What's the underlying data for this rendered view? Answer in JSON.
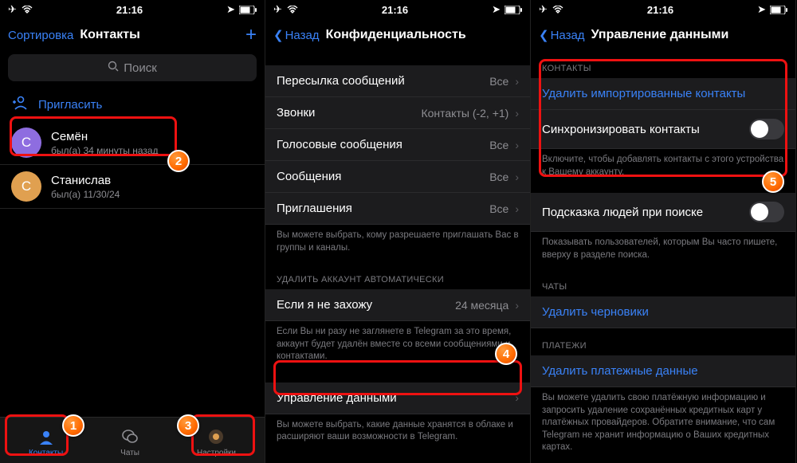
{
  "statusbar": {
    "time": "21:16"
  },
  "screen1": {
    "sort": "Сортировка",
    "title": "Контакты",
    "search_placeholder": "Поиск",
    "invite": "Пригласить",
    "contacts": [
      {
        "initial": "С",
        "name": "Семён",
        "status": "был(а) 34 минуты назад"
      },
      {
        "initial": "С",
        "name": "Станислав",
        "status": "был(а) 11/30/24"
      }
    ],
    "tabs": {
      "contacts": "Контакты",
      "chats": "Чаты",
      "settings": "Настройки"
    }
  },
  "screen2": {
    "back": "Назад",
    "title": "Конфиденциальность",
    "rows": [
      {
        "label": "Пересылка сообщений",
        "value": "Все"
      },
      {
        "label": "Звонки",
        "value": "Контакты (-2, +1)"
      },
      {
        "label": "Голосовые сообщения",
        "value": "Все"
      },
      {
        "label": "Сообщения",
        "value": "Все"
      },
      {
        "label": "Приглашения",
        "value": "Все"
      }
    ],
    "footer1": "Вы можете выбрать, кому разрешаете приглашать Вас в группы и каналы.",
    "section2_header": "УДАЛИТЬ АККАУНТ АВТОМАТИЧЕСКИ",
    "inactive_label": "Если я не захожу",
    "inactive_value": "24 месяца",
    "footer2": "Если Вы ни разу не заглянете в Telegram за это время, аккаунт будет удалён вместе со всеми сообщениями и контактами.",
    "data_mgmt": "Управление данными",
    "footer3": "Вы можете выбрать, какие данные хранятся в облаке и расширяют ваши возможности в Telegram."
  },
  "screen3": {
    "back": "Назад",
    "title": "Управление данными",
    "section_contacts": "КОНТАКТЫ",
    "delete_contacts": "Удалить импортированные контакты",
    "sync_contacts": "Синхронизировать контакты",
    "footer_contacts": "Включите, чтобы добавлять контакты с этого устройства к Вашему аккаунту.",
    "suggest_people": "Подсказка людей при поиске",
    "footer_suggest": "Показывать пользователей, которым Вы часто пишете, вверху в разделе поиска.",
    "section_chats": "ЧАТЫ",
    "delete_drafts": "Удалить черновики",
    "section_payments": "ПЛАТЕЖИ",
    "delete_payments": "Удалить платежные данные",
    "footer_payments": "Вы можете удалить свою платёжную информацию и запросить удаление сохранённых кредитных карт у платёжных провайдеров. Обратите внимание, что сам Telegram не хранит информацию о Ваших кредитных картах."
  },
  "badges": {
    "b1": "1",
    "b2": "2",
    "b3": "3",
    "b4": "4",
    "b5": "5"
  }
}
